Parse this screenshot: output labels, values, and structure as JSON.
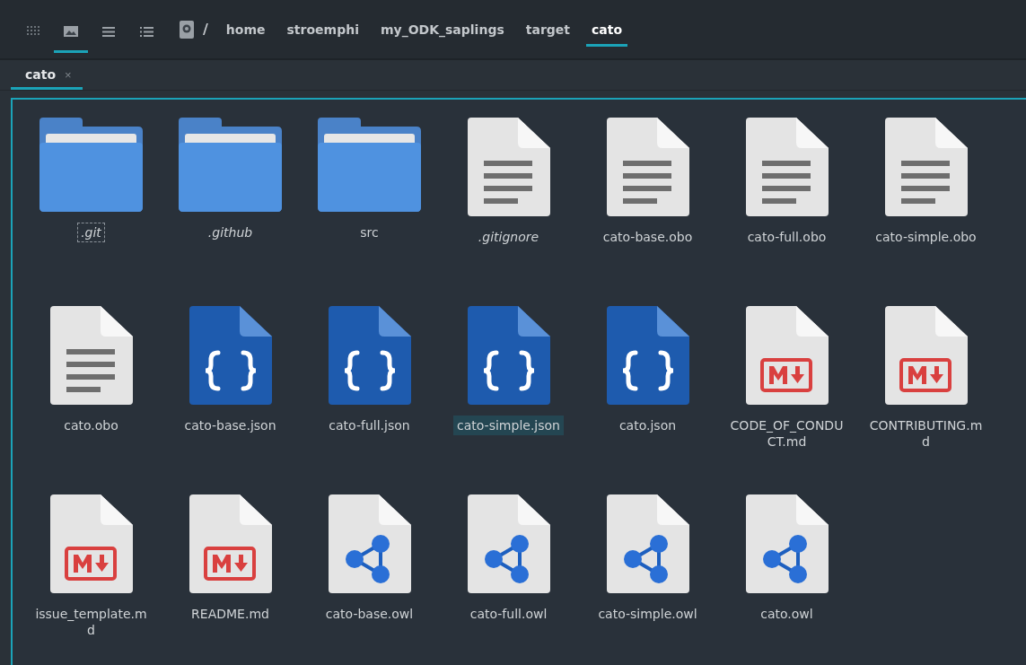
{
  "toolbar": {
    "view_buttons": [
      {
        "kind": "grid",
        "selected": false
      },
      {
        "kind": "icons",
        "selected": true
      },
      {
        "kind": "compact",
        "selected": false
      },
      {
        "kind": "details",
        "selected": false
      }
    ],
    "path_root": "/",
    "breadcrumbs": [
      {
        "label": "home",
        "selected": false
      },
      {
        "label": "stroemphi",
        "selected": false
      },
      {
        "label": "my_ODK_saplings",
        "selected": false
      },
      {
        "label": "target",
        "selected": false
      },
      {
        "label": "cato",
        "selected": true
      }
    ]
  },
  "tabs": [
    {
      "label": "cato",
      "close": "×",
      "selected": true
    }
  ],
  "files": [
    {
      "name": ".git",
      "kind": "folder",
      "hidden": true,
      "focused": true,
      "selected": false
    },
    {
      "name": ".github",
      "kind": "folder",
      "hidden": true,
      "focused": false,
      "selected": false
    },
    {
      "name": "src",
      "kind": "folder",
      "hidden": false,
      "focused": false,
      "selected": false
    },
    {
      "name": ".gitignore",
      "kind": "text",
      "hidden": true,
      "focused": false,
      "selected": false
    },
    {
      "name": "cato-base.obo",
      "kind": "text",
      "hidden": false,
      "focused": false,
      "selected": false
    },
    {
      "name": "cato-full.obo",
      "kind": "text",
      "hidden": false,
      "focused": false,
      "selected": false
    },
    {
      "name": "cato-simple.obo",
      "kind": "text",
      "hidden": false,
      "focused": false,
      "selected": false
    },
    {
      "name": "cato.obo",
      "kind": "text",
      "hidden": false,
      "focused": false,
      "selected": false
    },
    {
      "name": "cato-base.json",
      "kind": "json",
      "hidden": false,
      "focused": false,
      "selected": false
    },
    {
      "name": "cato-full.json",
      "kind": "json",
      "hidden": false,
      "focused": false,
      "selected": false
    },
    {
      "name": "cato-simple.json",
      "kind": "json",
      "hidden": false,
      "focused": false,
      "selected": true
    },
    {
      "name": "cato.json",
      "kind": "json",
      "hidden": false,
      "focused": false,
      "selected": false
    },
    {
      "name": "CODE_OF_CONDUCT.md",
      "kind": "markdown",
      "hidden": false,
      "focused": false,
      "selected": false
    },
    {
      "name": "CONTRIBUTING.md",
      "kind": "markdown",
      "hidden": false,
      "focused": false,
      "selected": false
    },
    {
      "name": "issue_template.md",
      "kind": "markdown",
      "hidden": false,
      "focused": false,
      "selected": false
    },
    {
      "name": "README.md",
      "kind": "markdown",
      "hidden": false,
      "focused": false,
      "selected": false
    },
    {
      "name": "cato-base.owl",
      "kind": "owl",
      "hidden": false,
      "focused": false,
      "selected": false
    },
    {
      "name": "cato-full.owl",
      "kind": "owl",
      "hidden": false,
      "focused": false,
      "selected": false
    },
    {
      "name": "cato-simple.owl",
      "kind": "owl",
      "hidden": false,
      "focused": false,
      "selected": false
    },
    {
      "name": "cato.owl",
      "kind": "owl",
      "hidden": false,
      "focused": false,
      "selected": false
    }
  ]
}
